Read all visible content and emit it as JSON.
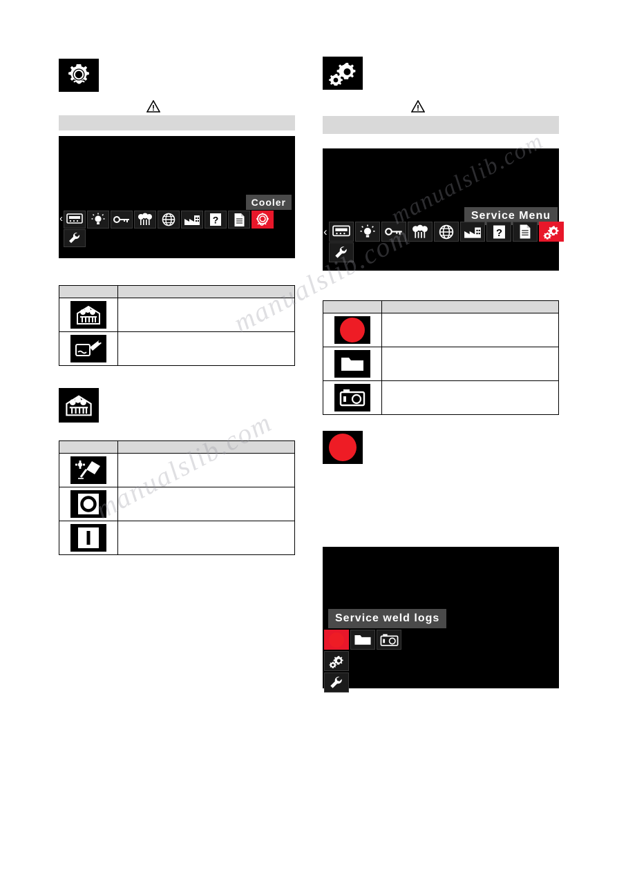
{
  "watermark": {
    "lines": [
      "manualslib",
      ".com",
      "manualslib",
      "manualslib.com"
    ],
    "text": "manualslib.com"
  },
  "left": {
    "header_icon": "gear-cooler-icon",
    "warning": "⚠",
    "display": {
      "tooltip": "Cooler",
      "icons_row1": [
        "display-icon",
        "light-bulb-icon",
        "key-icon",
        "fan-icon",
        "globe-icon",
        "factory-icon",
        "question-icon",
        "document-icon",
        "cooler-icon"
      ],
      "icons_row2": [
        "wrench-icon"
      ]
    },
    "table1": {
      "headers": [
        "",
        ""
      ],
      "rows": [
        {
          "icon": "cooler-settings-icon",
          "text": ""
        },
        {
          "icon": "coolant-fill-icon",
          "text": ""
        }
      ]
    },
    "section_icon": "cooler-settings-icon",
    "table2": {
      "headers": [
        "",
        ""
      ],
      "rows": [
        {
          "icon": "torch-auto-icon",
          "text": ""
        },
        {
          "icon": "off-icon",
          "text": ""
        },
        {
          "icon": "on-icon",
          "text": ""
        }
      ]
    }
  },
  "right": {
    "header_icon": "service-gears-icon",
    "warning": "⚠",
    "display": {
      "tooltip": "Service  Menu",
      "icons_row1": [
        "display-icon",
        "light-bulb-icon",
        "key-icon",
        "fan-icon",
        "globe-icon",
        "factory-icon",
        "question-icon",
        "document-icon",
        "service-gears-icon"
      ],
      "icons_row2": [
        "wrench-icon"
      ]
    },
    "table1": {
      "headers": [
        "",
        ""
      ],
      "rows": [
        {
          "icon": "red-record-icon",
          "text": ""
        },
        {
          "icon": "folder-icon",
          "text": ""
        },
        {
          "icon": "camera-icon",
          "text": ""
        }
      ]
    },
    "section_icon": "red-record-icon",
    "display2": {
      "tooltip": "Service  weld  logs",
      "icons_row1": [
        "red-record-icon",
        "folder-icon",
        "camera-icon"
      ],
      "icons_row2": [
        "service-gears-icon"
      ],
      "icons_row3": [
        "wrench-icon"
      ]
    }
  }
}
